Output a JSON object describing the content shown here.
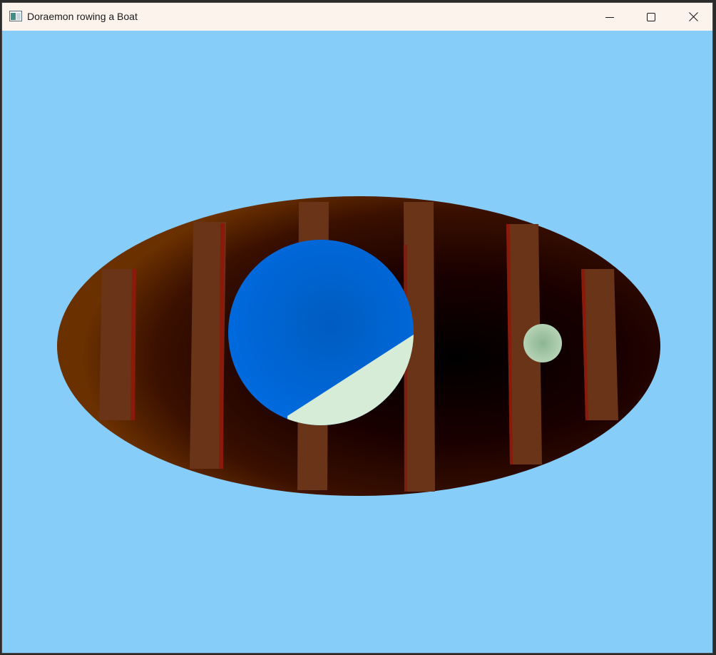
{
  "window": {
    "title": "Doraemon rowing a Boat",
    "icons": {
      "app": "app-window-icon",
      "minimize": "minimize-icon",
      "maximize": "maximize-icon",
      "close": "close-icon"
    }
  },
  "scene": {
    "colors": {
      "sky": "#87cdf9",
      "boat_edge": "#6a3000",
      "boat_center": "#000000",
      "plank": "#6a3419",
      "plank_shadow": "#8a1a0a",
      "doraemon_blue": "#006be0",
      "doraemon_white": "#d6ecd6",
      "small_ball": "#9ec5a2"
    }
  }
}
